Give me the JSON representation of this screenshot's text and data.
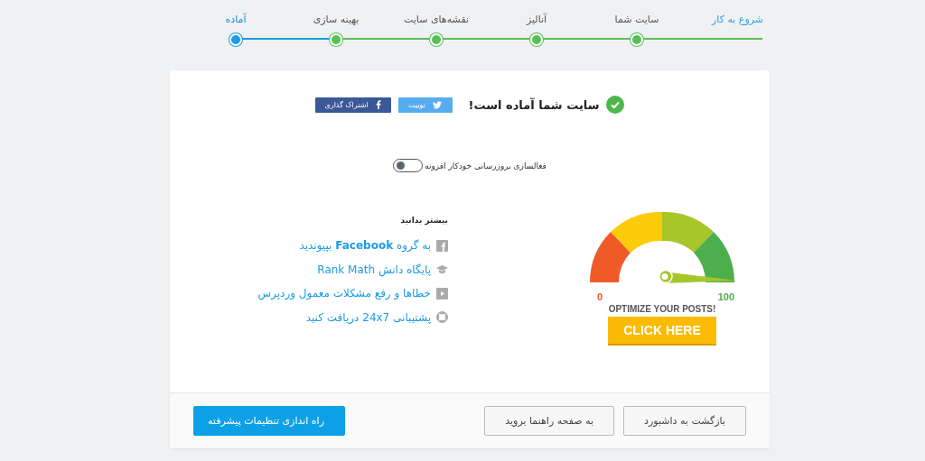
{
  "steps": [
    {
      "label": "شروع به کار",
      "selected": false,
      "marker": false
    },
    {
      "label": "سایت شما",
      "selected": false,
      "marker": true
    },
    {
      "label": "آنالیز",
      "selected": false,
      "marker": true
    },
    {
      "label": "نقشه‌های سایت",
      "selected": false,
      "marker": true
    },
    {
      "label": "بهینه سازی",
      "selected": false,
      "marker": true
    },
    {
      "label": "آماده",
      "selected": true,
      "marker": true
    }
  ],
  "header": {
    "title": "سایت شما آماده است!",
    "share_buttons": [
      {
        "kind": "twitter",
        "label": "توییت"
      },
      {
        "kind": "facebook",
        "label": "اشتراک گذاری"
      }
    ]
  },
  "auto_update": {
    "label": "فعالسازی بروزرسانی خودکار افزونه",
    "on": false
  },
  "ad": {
    "min": "0",
    "max": "100",
    "caption": "OPTIMIZE YOUR POSTS!",
    "button": "CLICK HERE"
  },
  "learn_more": {
    "title": "بیشتر بدانید",
    "links": [
      {
        "kind": "facebook",
        "text": "به گروه **Facebook** بپیوندید"
      },
      {
        "kind": "graduation",
        "text": "پایگاه دانش Rank Math"
      },
      {
        "kind": "video",
        "text": "خطاها و رفع مشکلات معمول وردپرس"
      },
      {
        "kind": "support",
        "text": "پشتیبانی 24x7 دریافت کنید"
      }
    ]
  },
  "footer": {
    "buttons": [
      {
        "kind": "secondary",
        "label": "بازگشت به داشبورد"
      },
      {
        "kind": "secondary",
        "label": "به صفحه راهنما بروید"
      },
      {
        "kind": "primary",
        "label": "راه اندازی تنظیمات پیشرفته"
      }
    ]
  }
}
